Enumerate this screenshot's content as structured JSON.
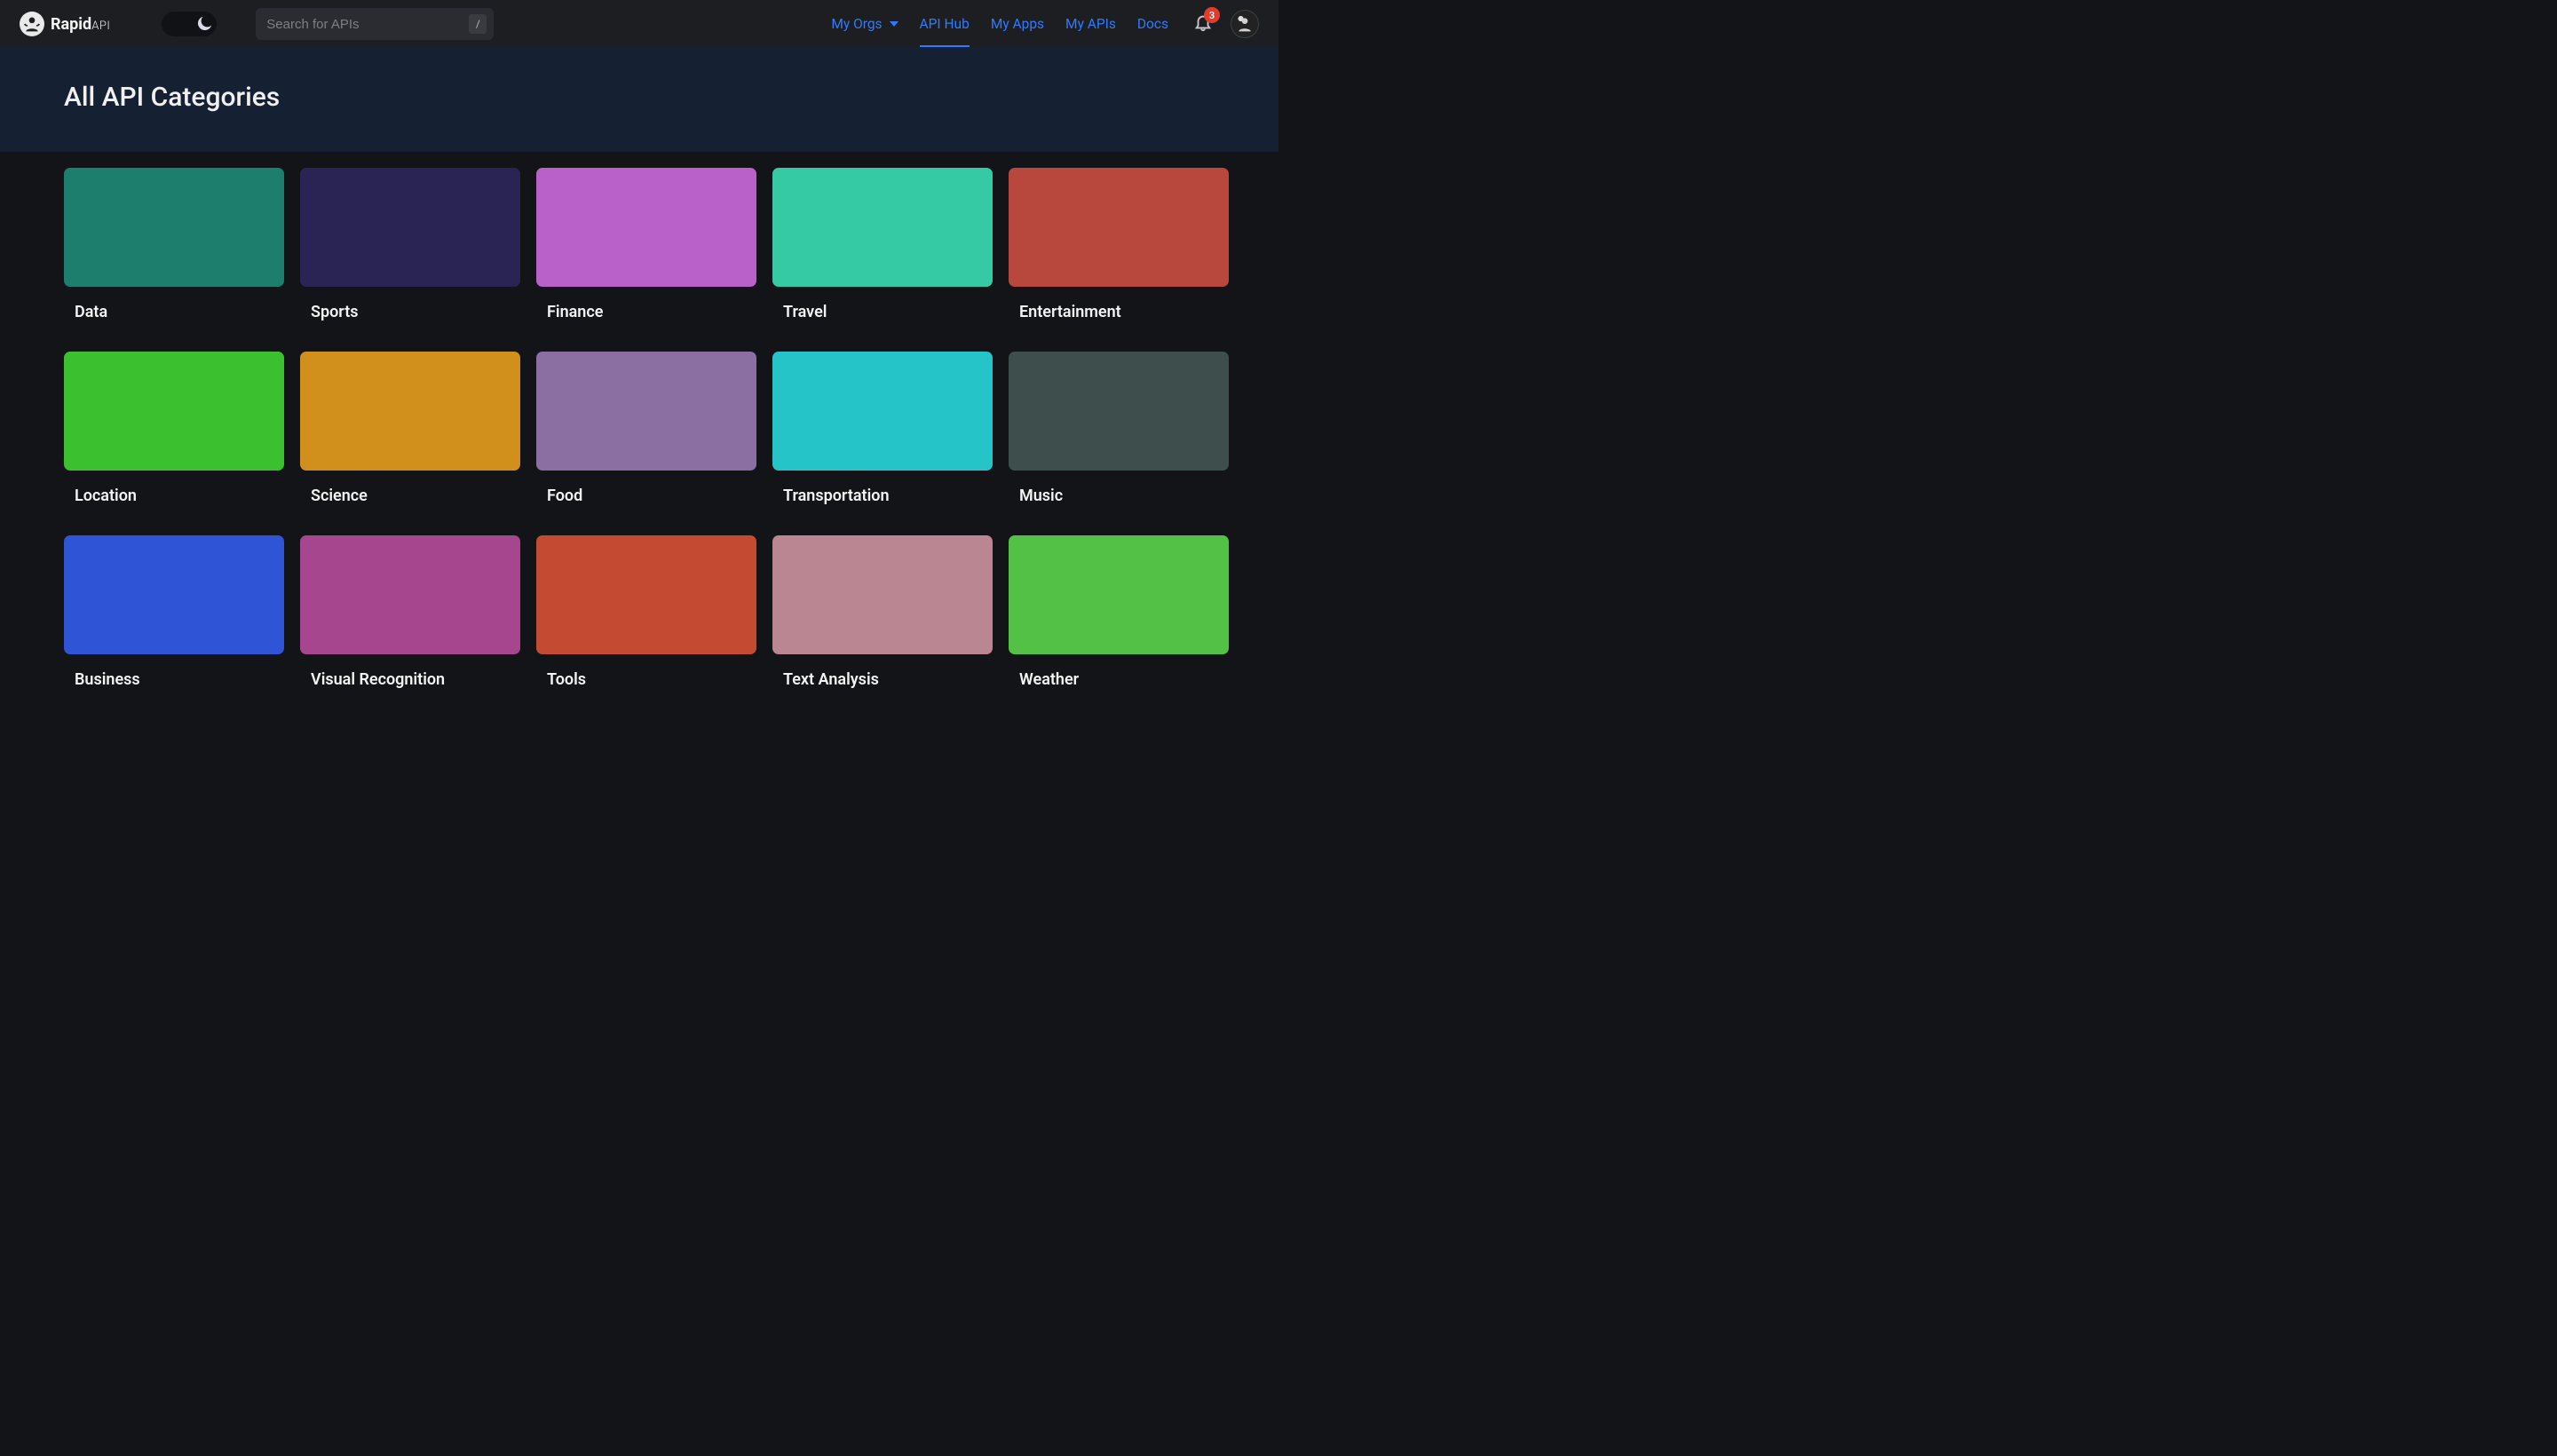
{
  "brand": {
    "name": "Rapid",
    "suffix": "API"
  },
  "search": {
    "placeholder": "Search for APIs",
    "shortcut": "/"
  },
  "nav": {
    "orgs": "My Orgs",
    "hub": "API Hub",
    "apps": "My Apps",
    "apis": "My APIs",
    "docs": "Docs"
  },
  "notifications": {
    "count": "3"
  },
  "page": {
    "title": "All API Categories"
  },
  "categories": [
    {
      "label": "Data",
      "color": "#1e7e6d"
    },
    {
      "label": "Sports",
      "color": "#2a2454"
    },
    {
      "label": "Finance",
      "color": "#b961c9"
    },
    {
      "label": "Travel",
      "color": "#35c9a4"
    },
    {
      "label": "Entertainment",
      "color": "#b8473d"
    },
    {
      "label": "Location",
      "color": "#3bc12f"
    },
    {
      "label": "Science",
      "color": "#d18f1c"
    },
    {
      "label": "Food",
      "color": "#8b6fa3"
    },
    {
      "label": "Transportation",
      "color": "#24c4c9"
    },
    {
      "label": "Music",
      "color": "#3d4e4c"
    },
    {
      "label": "Business",
      "color": "#2f54d6"
    },
    {
      "label": "Visual Recognition",
      "color": "#a6468e"
    },
    {
      "label": "Tools",
      "color": "#c54a32"
    },
    {
      "label": "Text Analysis",
      "color": "#b98691"
    },
    {
      "label": "Weather",
      "color": "#53c146"
    }
  ]
}
